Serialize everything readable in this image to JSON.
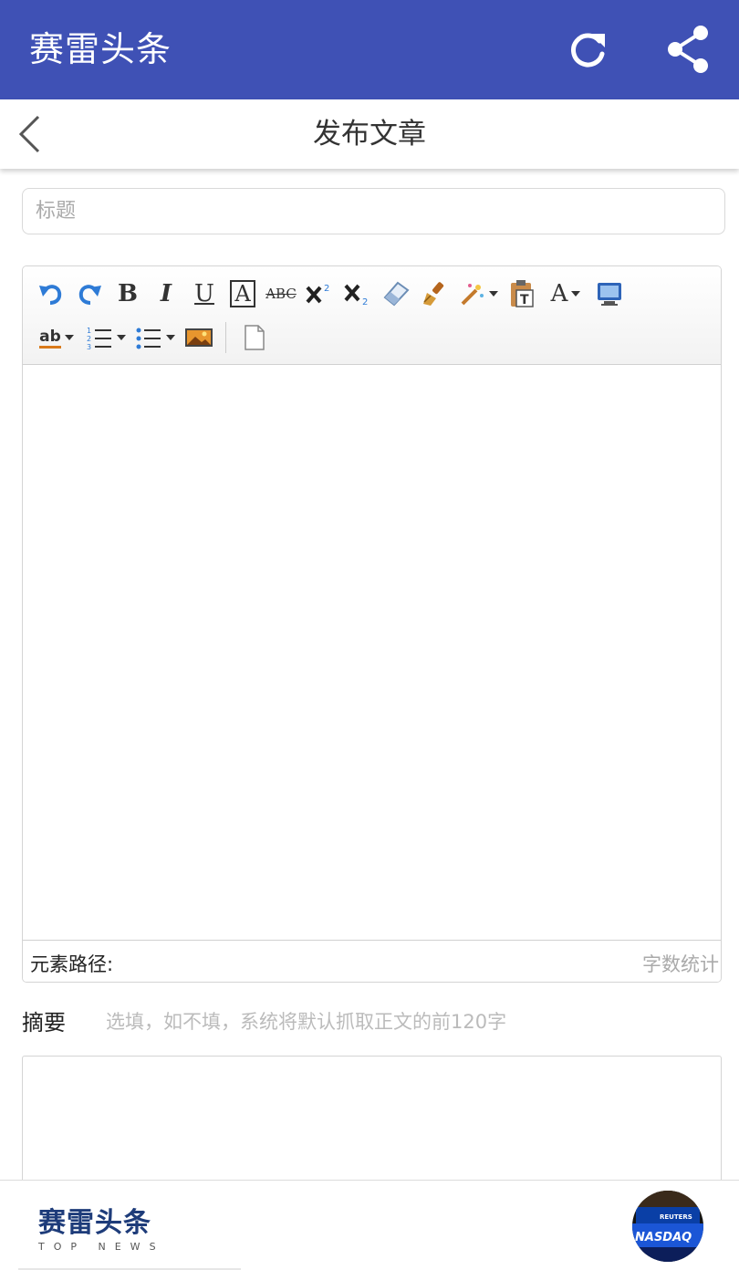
{
  "appbar": {
    "title": "赛雷头条",
    "refresh_icon": "refresh-icon",
    "share_icon": "share-icon",
    "color": "#3f51b5"
  },
  "subbar": {
    "title": "发布文章",
    "back_icon": "chevron-left-icon"
  },
  "title_field": {
    "placeholder": "标题",
    "value": ""
  },
  "editor": {
    "toolbar_row1": [
      "undo-icon",
      "redo-icon",
      "bold-icon",
      "italic-icon",
      "underline-icon",
      "font-border-icon",
      "strikethrough-icon",
      "superscript-icon",
      "subscript-icon",
      "eraser-icon",
      "format-brush-icon",
      "magic-wand-icon",
      "paste-text-icon",
      "font-color-icon",
      "preview-icon"
    ],
    "toolbar_row2": [
      "spellcheck-icon",
      "ordered-list-icon",
      "unordered-list-icon",
      "image-icon",
      "new-document-icon"
    ],
    "labels": {
      "bold": "B",
      "italic": "I",
      "underline": "U",
      "font_border": "A",
      "strike": "ABC",
      "font_color": "A",
      "spellcheck": "ab"
    },
    "element_path_label": "元素路径:",
    "word_count_label": "字数统计"
  },
  "summary": {
    "label": "摘要",
    "hint": "选填，如不填，系统将默认抓取正文的前120字"
  },
  "footer": {
    "logo_cn": "赛雷头条",
    "logo_en": "TOP NEWS",
    "avatar": "nasdaq-avatar",
    "avatar_text_1": "REUTERS",
    "avatar_text_2": "NASDAQ"
  }
}
